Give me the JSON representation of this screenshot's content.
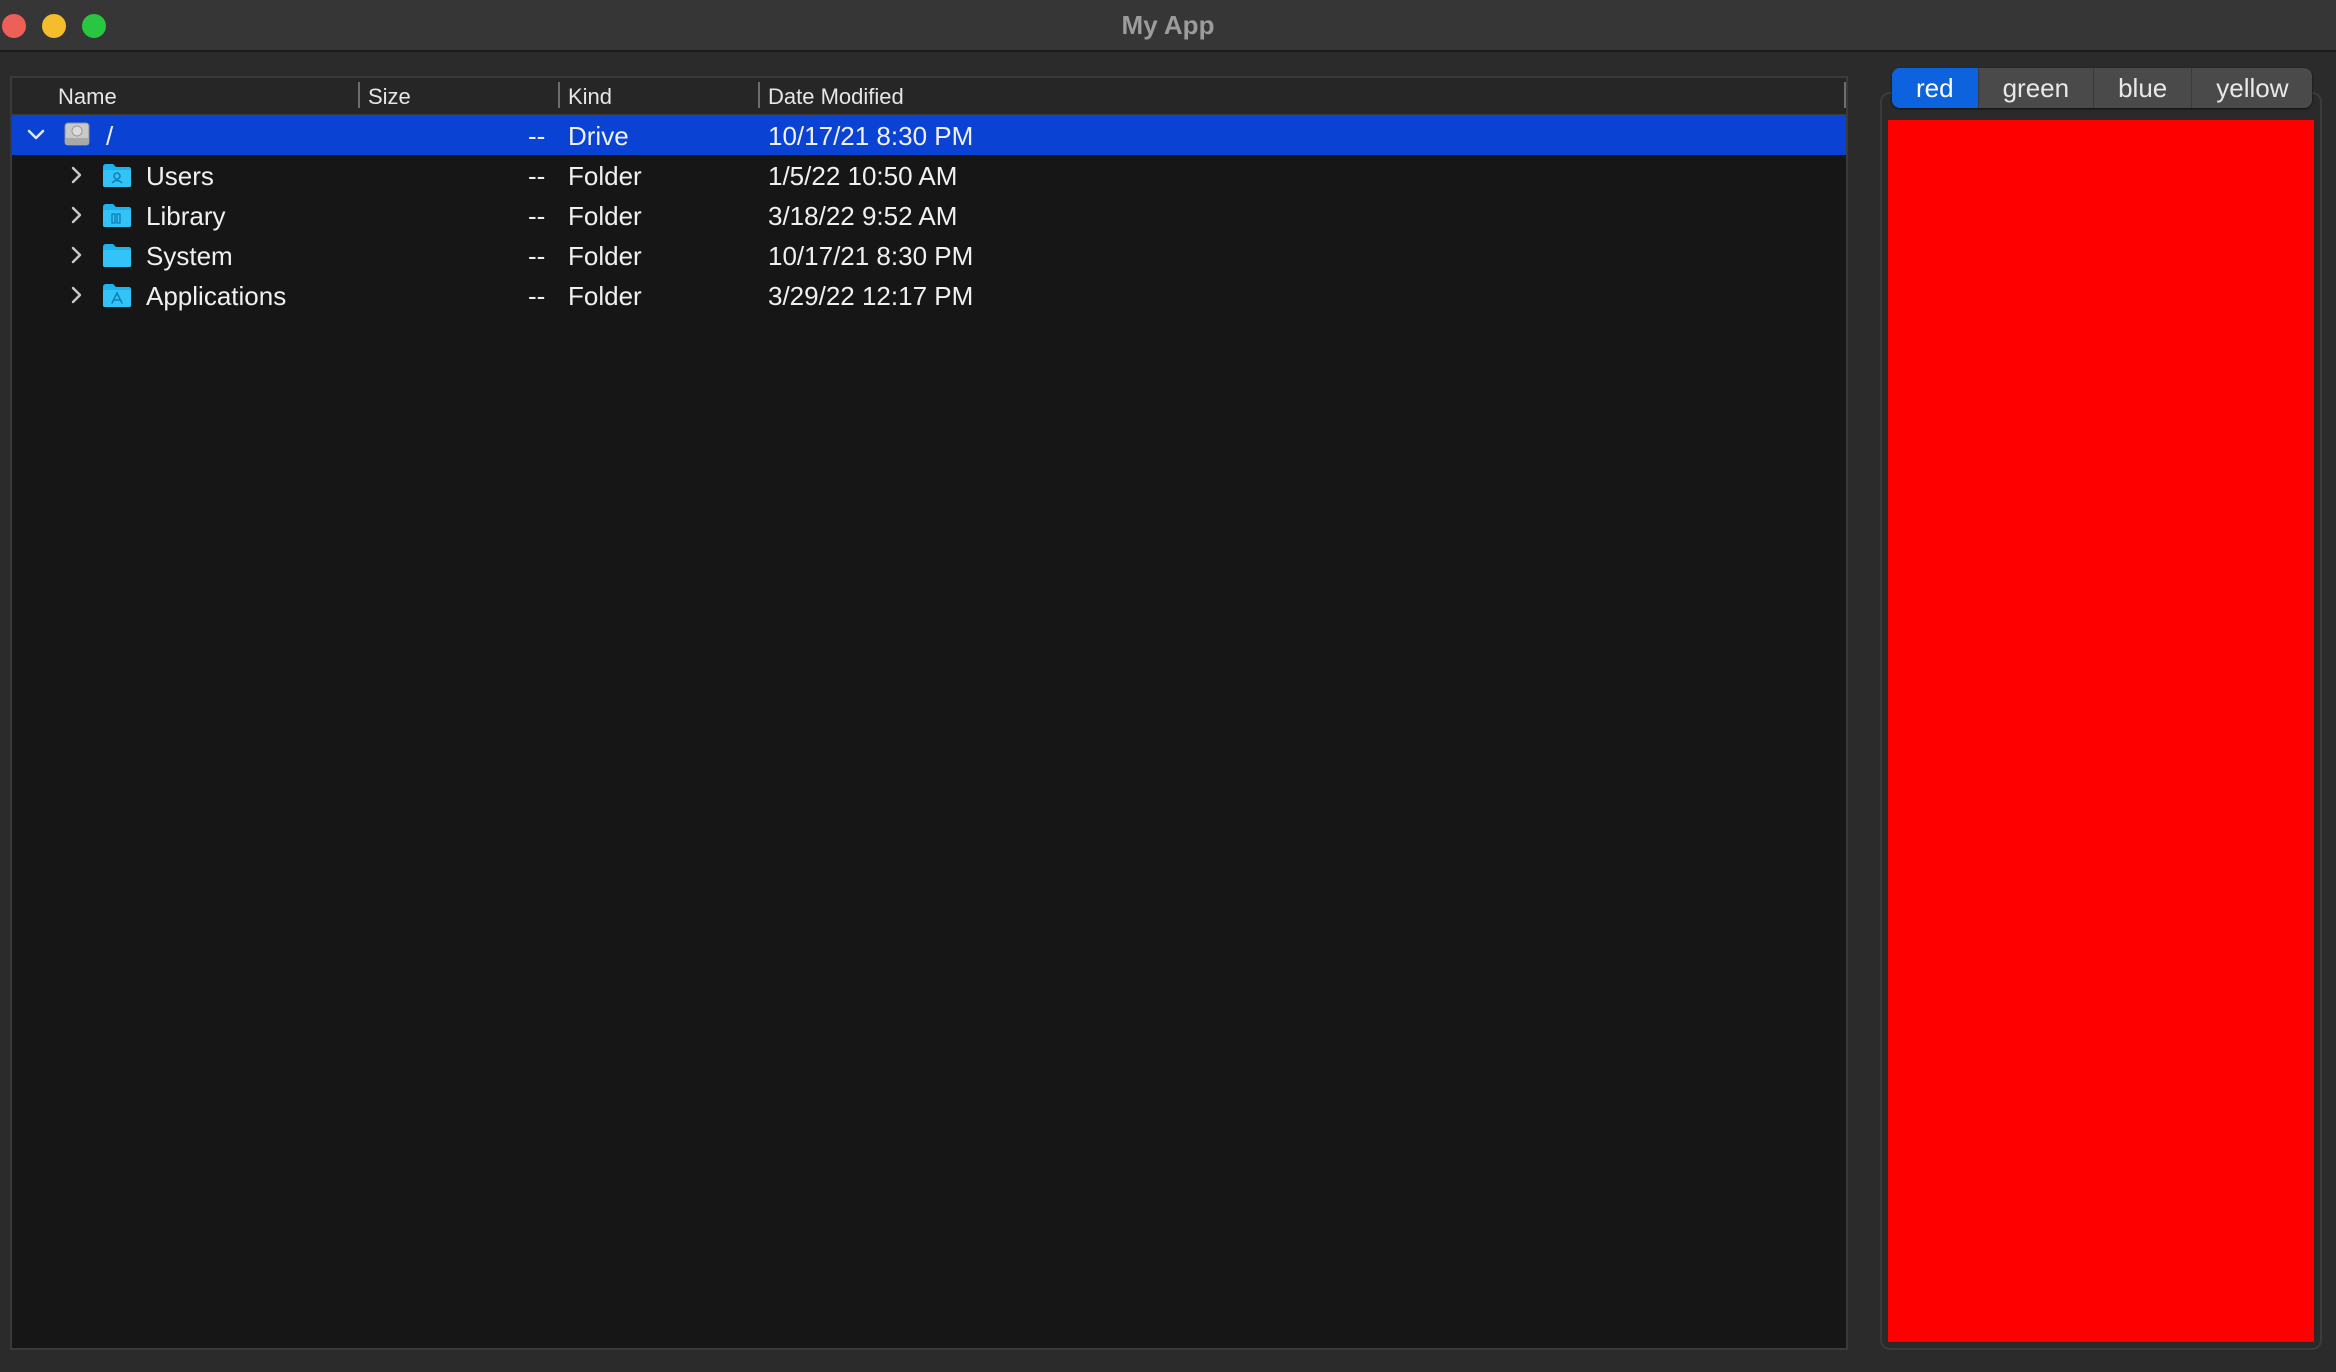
{
  "window": {
    "title": "My App"
  },
  "tree": {
    "columns": [
      {
        "label": "Name"
      },
      {
        "label": "Size"
      },
      {
        "label": "Kind"
      },
      {
        "label": "Date Modified"
      }
    ],
    "rows": [
      {
        "name": "/",
        "size": "--",
        "kind": "Drive",
        "date": "10/17/21 8:30 PM",
        "icon": "drive-icon",
        "expanded": true,
        "selected": true,
        "level": 0
      },
      {
        "name": "Users",
        "size": "--",
        "kind": "Folder",
        "date": "1/5/22 10:50 AM",
        "icon": "users-folder-icon",
        "expanded": false,
        "selected": false,
        "level": 1
      },
      {
        "name": "Library",
        "size": "--",
        "kind": "Folder",
        "date": "3/18/22 9:52 AM",
        "icon": "library-folder-icon",
        "expanded": false,
        "selected": false,
        "level": 1
      },
      {
        "name": "System",
        "size": "--",
        "kind": "Folder",
        "date": "10/17/21 8:30 PM",
        "icon": "system-folder-icon",
        "expanded": false,
        "selected": false,
        "level": 1
      },
      {
        "name": "Applications",
        "size": "--",
        "kind": "Folder",
        "date": "3/29/22 12:17 PM",
        "icon": "applications-folder-icon",
        "expanded": false,
        "selected": false,
        "level": 1
      }
    ]
  },
  "tabs": {
    "items": [
      {
        "label": "red",
        "active": true
      },
      {
        "label": "green",
        "active": false
      },
      {
        "label": "blue",
        "active": false
      },
      {
        "label": "yellow",
        "active": false
      }
    ],
    "content_color": "#ff0000"
  },
  "colors": {
    "selection": "#0a43d3",
    "folder": "#1ab4f0",
    "active_tab": "#0d63dd"
  }
}
